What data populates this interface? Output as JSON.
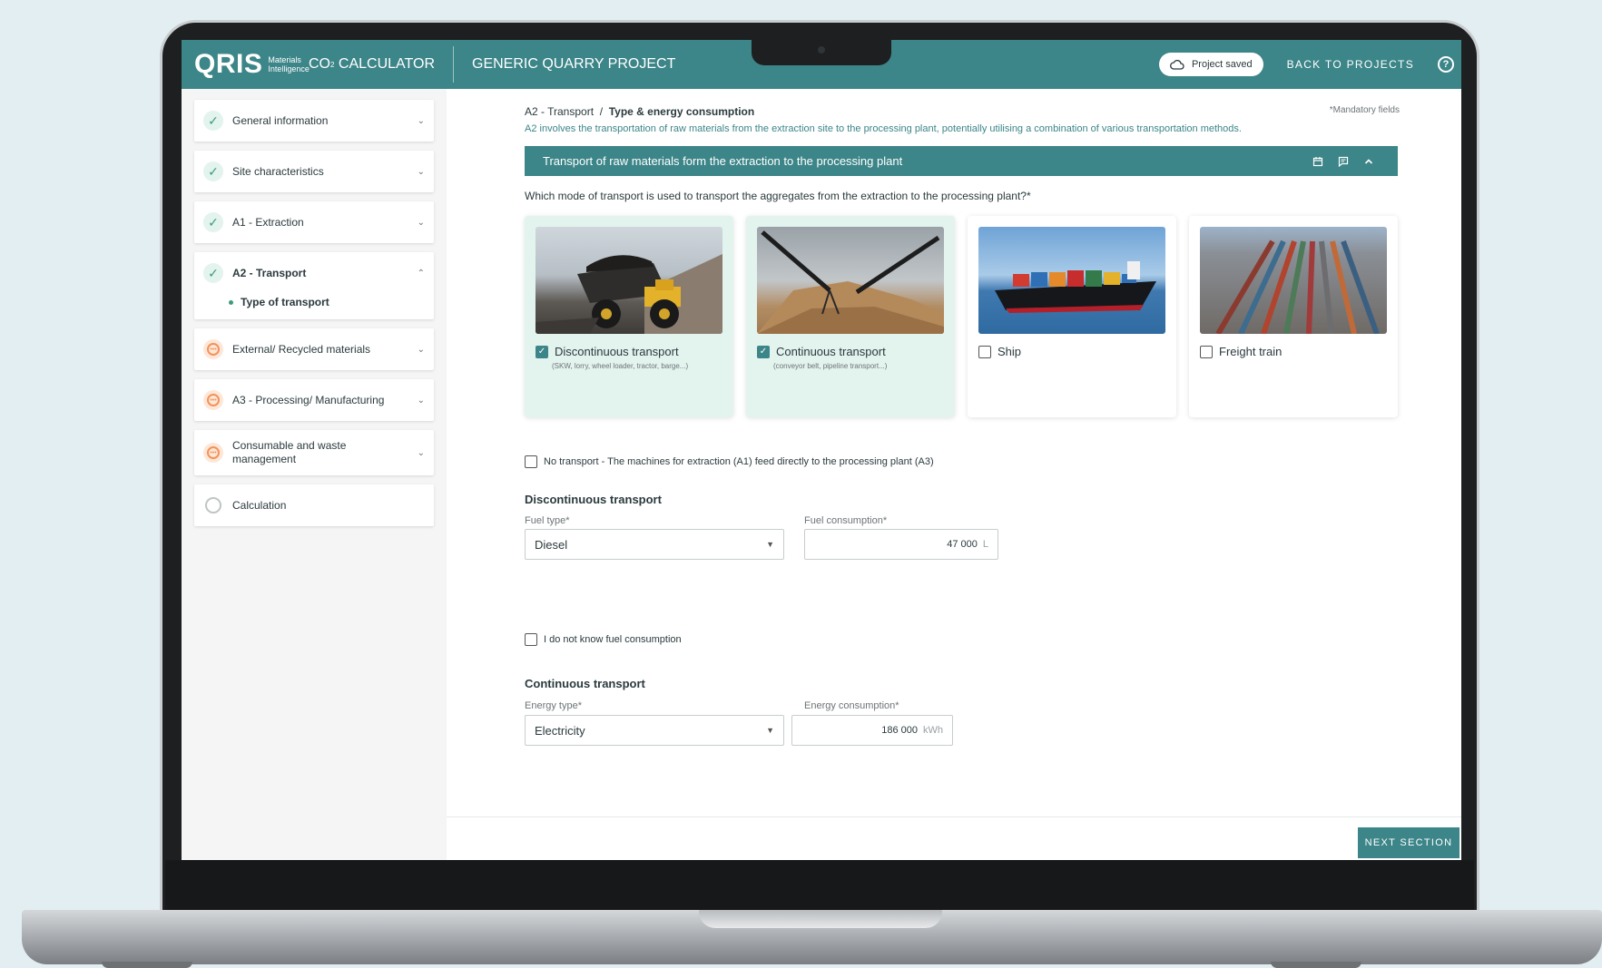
{
  "header": {
    "logo": "QRIS",
    "logo_sub_1": "Materials",
    "logo_sub_2": "Intelligence",
    "calc_prefix": "CO",
    "calc_subscript": "2",
    "calc_suffix": " CALCULATOR",
    "project": "GENERIC QUARRY PROJECT",
    "saved": "Project saved",
    "back": "BACK TO PROJECTS"
  },
  "sidebar": {
    "items": [
      {
        "label": "General information",
        "status": "done"
      },
      {
        "label": "Site characteristics",
        "status": "done"
      },
      {
        "label": "A1 - Extraction",
        "status": "done"
      },
      {
        "label": "A2 - Transport",
        "status": "done",
        "expanded": true,
        "sub": "Type of transport"
      },
      {
        "label": "External/ Recycled materials",
        "status": "pending"
      },
      {
        "label": "A3 - Processing/ Manufacturing",
        "status": "pending"
      },
      {
        "label": "Consumable and waste management",
        "status": "pending"
      },
      {
        "label": "Calculation",
        "status": "empty"
      }
    ]
  },
  "main": {
    "breadcrumb_parent": "A2 - Transport",
    "breadcrumb_sep": "/",
    "breadcrumb_current": "Type & energy consumption",
    "mandatory": "*Mandatory fields",
    "intro": "A2 involves the transportation of raw materials from the extraction site to the processing plant, potentially utilising a combination of various transportation methods.",
    "section_title": "Transport of raw materials form the extraction to the processing plant",
    "question": "Which mode of transport is used to transport the aggregates from the extraction to the processing plant?*",
    "cards": [
      {
        "label": "Discontinuous transport",
        "sub": "(SKW, lorry, wheel loader, tractor, barge...)",
        "checked": true
      },
      {
        "label": "Continuous transport",
        "sub": "(conveyor belt, pipeline transport...)",
        "checked": true
      },
      {
        "label": "Ship",
        "sub": "",
        "checked": false
      },
      {
        "label": "Freight train",
        "sub": "",
        "checked": false
      }
    ],
    "no_transport": "No transport - The machines for extraction (A1) feed directly to the processing plant (A3)",
    "discontinuous": {
      "title": "Discontinuous transport",
      "fuel_type_label": "Fuel type*",
      "fuel_type_value": "Diesel",
      "fuel_consumption_label": "Fuel consumption*",
      "fuel_consumption_value": "47 000",
      "fuel_unit": "L",
      "unknown_label": "I do not know fuel consumption"
    },
    "continuous": {
      "title": "Continuous transport",
      "energy_type_label": "Energy type*",
      "energy_type_value": "Electricity",
      "energy_consumption_label": "Energy consumption*",
      "energy_consumption_value": "186 000",
      "energy_unit": "kWh"
    },
    "next": "NEXT SECTION"
  },
  "icons": {
    "check": "check-icon",
    "pending": "dots-circle-icon",
    "cloud": "cloud-icon",
    "help": "help-icon",
    "calendar": "calendar-icon",
    "comment": "comment-icon",
    "chevron": "chevron-icon"
  },
  "colors": {
    "primary": "#3c8588",
    "done": "#3a9c79",
    "pending": "#f2935a",
    "selected_card": "#e3f3ee"
  }
}
